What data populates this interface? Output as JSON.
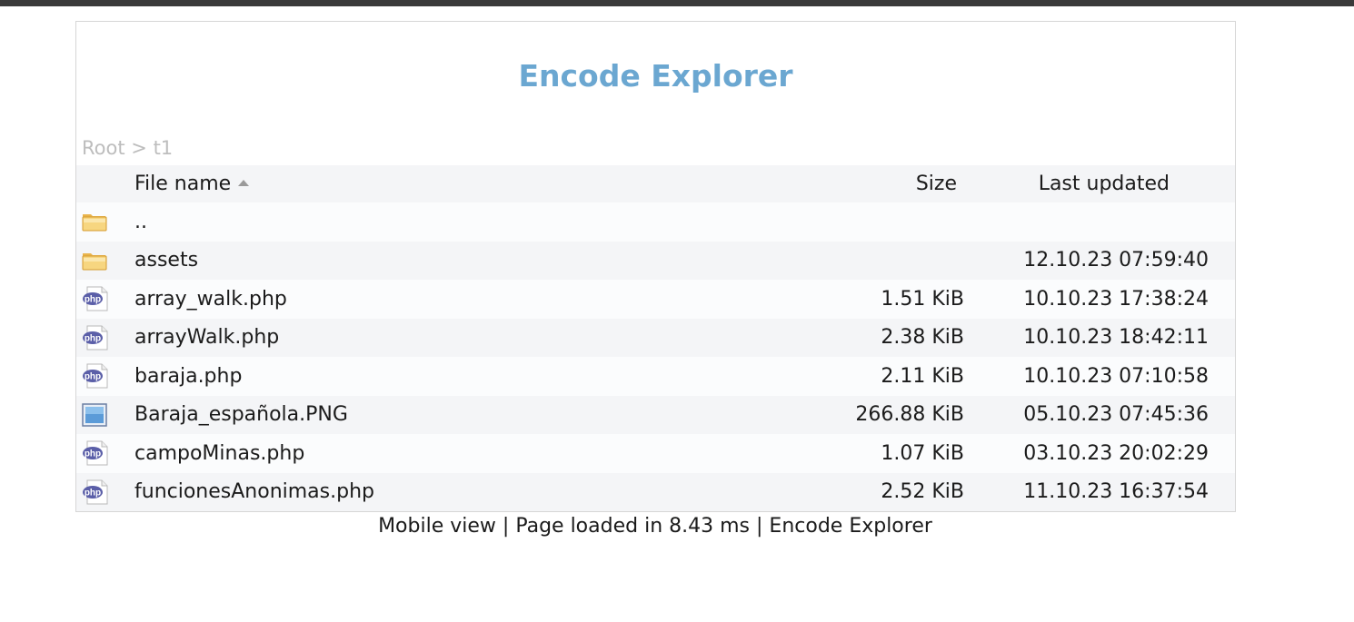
{
  "app": {
    "title": "Encode Explorer"
  },
  "breadcrumb": {
    "root": "Root",
    "separator": ">",
    "current": "t1"
  },
  "table": {
    "headers": {
      "name": "File name",
      "size": "Size",
      "updated": "Last updated"
    },
    "rows": [
      {
        "icon": "folder-icon",
        "name": "..",
        "size": "",
        "updated": ""
      },
      {
        "icon": "folder-icon",
        "name": "assets",
        "size": "",
        "updated": "12.10.23 07:59:40"
      },
      {
        "icon": "php-file-icon",
        "name": "array_walk.php",
        "size": "1.51 KiB",
        "updated": "10.10.23 17:38:24"
      },
      {
        "icon": "php-file-icon",
        "name": "arrayWalk.php",
        "size": "2.38 KiB",
        "updated": "10.10.23 18:42:11"
      },
      {
        "icon": "php-file-icon",
        "name": "baraja.php",
        "size": "2.11 KiB",
        "updated": "10.10.23 07:10:58"
      },
      {
        "icon": "image-file-icon",
        "name": "Baraja_española.PNG",
        "size": "266.88 KiB",
        "updated": "05.10.23 07:45:36"
      },
      {
        "icon": "php-file-icon",
        "name": "campoMinas.php",
        "size": "1.07 KiB",
        "updated": "03.10.23 20:02:29"
      },
      {
        "icon": "php-file-icon",
        "name": "funcionesAnonimas.php",
        "size": "2.52 KiB",
        "updated": "11.10.23 16:37:54"
      }
    ]
  },
  "footer": {
    "mobile_view": "Mobile view",
    "separator": "|",
    "load_time": "Page loaded in 8.43 ms",
    "brand": "Encode Explorer"
  },
  "colors": {
    "title": "#6ba7d1",
    "breadcrumb": "#bdbdbd",
    "row_light": "#fbfcfd",
    "row_alt": "#f4f5f7",
    "topbar": "#3a3a3a"
  }
}
